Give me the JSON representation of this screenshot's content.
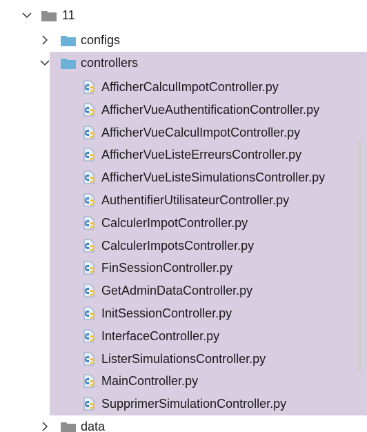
{
  "tree": {
    "root": {
      "label": "11",
      "expanded": true
    },
    "configs": {
      "label": "configs",
      "expanded": false
    },
    "controllers": {
      "label": "controllers",
      "expanded": true,
      "files": [
        "AfficherCalculImpotController.py",
        "AfficherVueAuthentificationController.py",
        "AfficherVueCalculImpotController.py",
        "AfficherVueListeErreursController.py",
        "AfficherVueListeSimulationsController.py",
        "AuthentifierUtilisateurController.py",
        "CalculerImpotController.py",
        "CalculerImpotsController.py",
        "FinSessionController.py",
        "GetAdminDataController.py",
        "InitSessionController.py",
        "InterfaceController.py",
        "ListerSimulationsController.py",
        "MainController.py",
        "SupprimerSimulationController.py"
      ]
    },
    "data": {
      "label": "data",
      "expanded": false
    }
  },
  "colors": {
    "selection": "#d9cde2",
    "folder_gray": "#8e8e8e",
    "folder_blue": "#6cb2d8",
    "python_blue": "#3f7fbf",
    "python_yellow": "#f0c330"
  },
  "icons": {
    "expanded": "chevron-down-icon",
    "collapsed": "chevron-right-icon",
    "folder": "folder-icon",
    "python_file": "python-file-icon"
  }
}
